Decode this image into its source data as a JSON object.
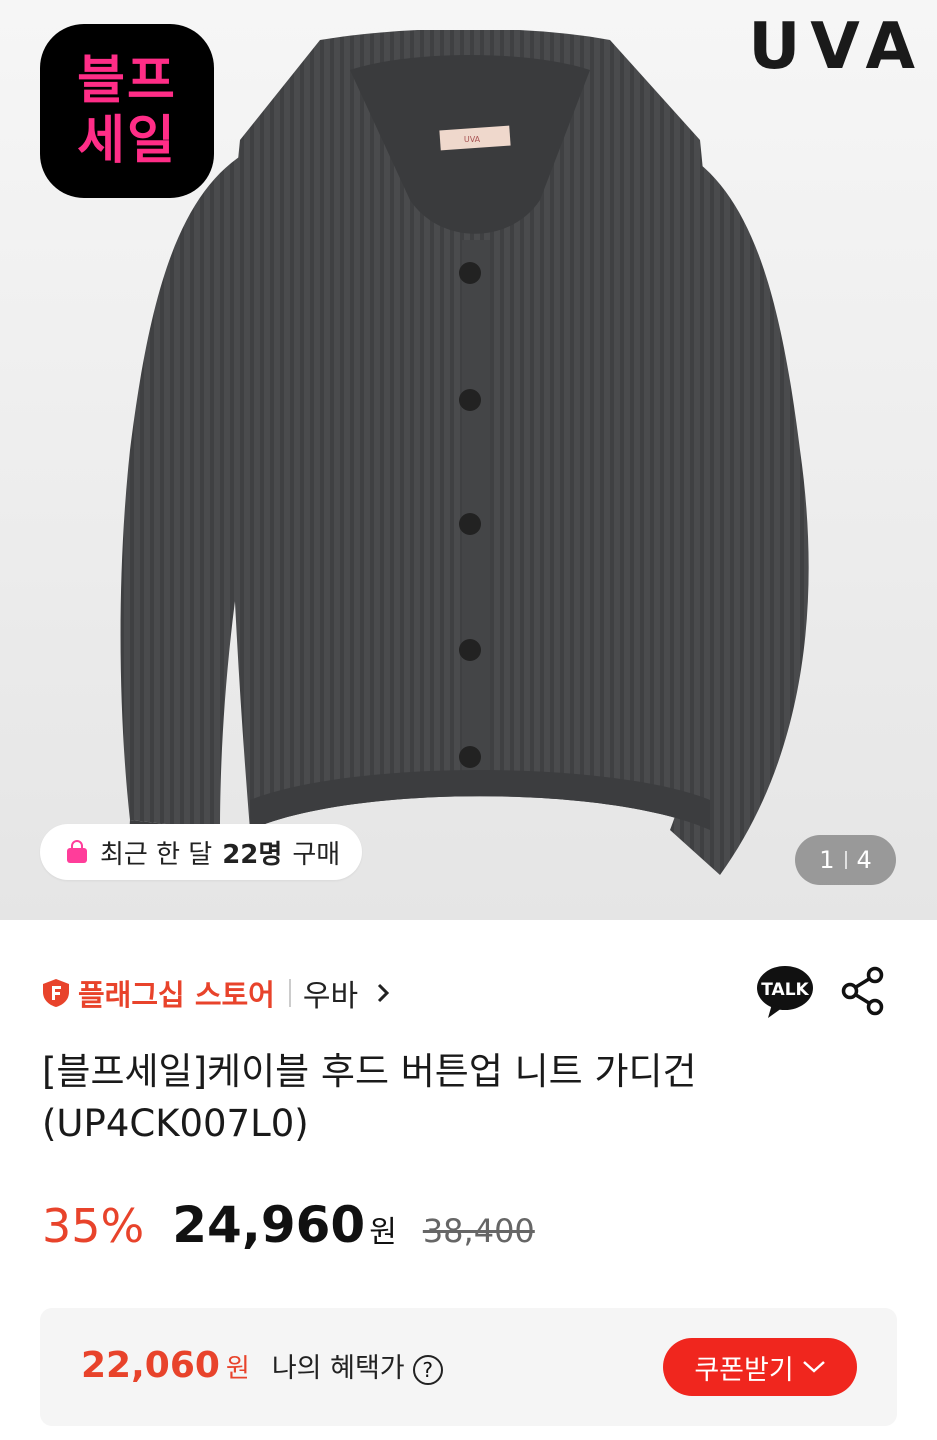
{
  "hero": {
    "badge_line1": "블프",
    "badge_line2": "세일",
    "brand_logo": "UVA",
    "label_text": "UVA",
    "purchase_prefix": "최근 한 달",
    "purchase_count": "22명",
    "purchase_suffix": "구매",
    "page_current": "1",
    "page_total": "4"
  },
  "store": {
    "badge_icon": "flagship-store-icon",
    "type": "플래그십 스토어",
    "brand": "우바",
    "talk_label": "TALK"
  },
  "product": {
    "title": "[블프세일]케이블 후드 버튼업 니트 가디건 (UP4CK007L0)"
  },
  "price": {
    "discount": "35%",
    "sale": "24,960",
    "currency": "원",
    "original": "38,400"
  },
  "benefit": {
    "price": "22,060",
    "currency": "원",
    "label": "나의 혜택가",
    "help": "?",
    "coupon_button": "쿠폰받기"
  },
  "colors": {
    "accent": "#e8432b",
    "coupon_bg": "#f0261e",
    "badge_text": "#ff2d87"
  }
}
